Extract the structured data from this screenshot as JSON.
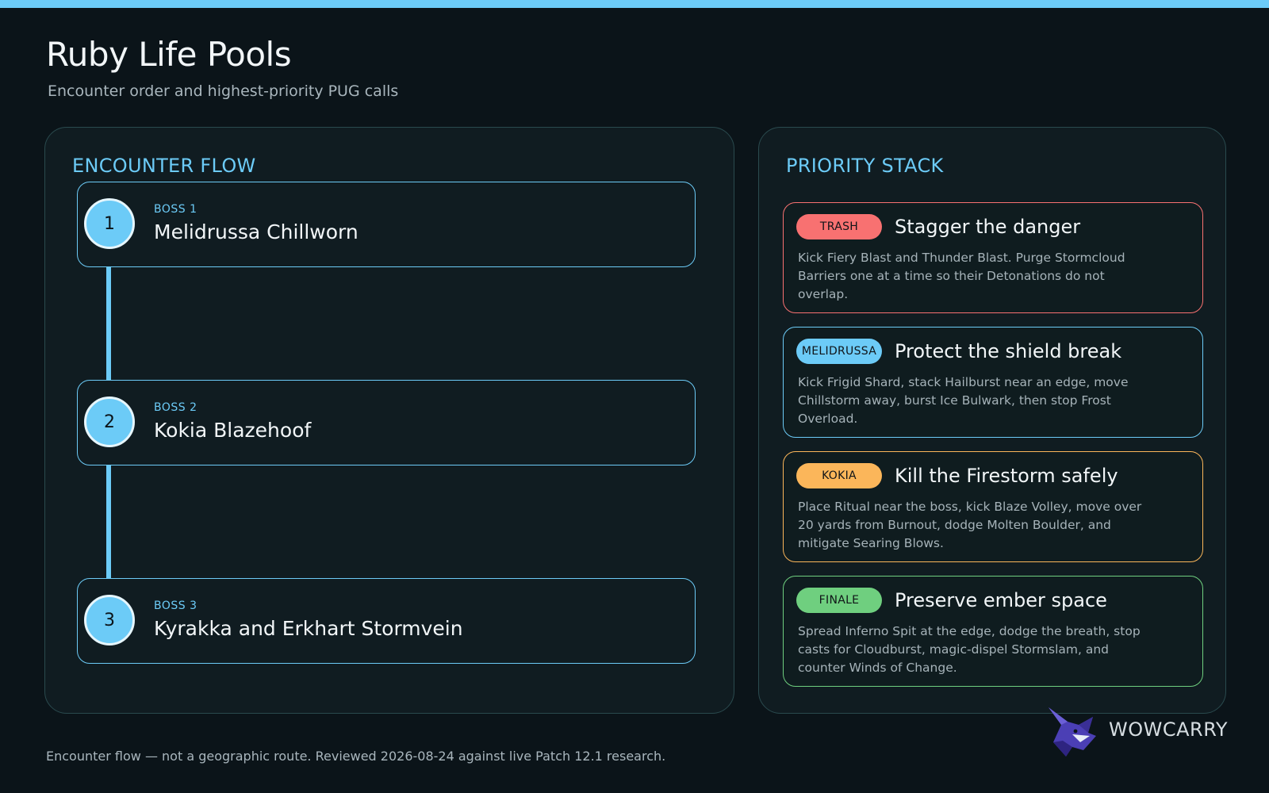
{
  "page": {
    "title": "Ruby Life Pools",
    "subtitle": "Encounter order and highest-priority PUG calls",
    "accent_color": "#6ccbf7"
  },
  "encounter_flow": {
    "heading": "ENCOUNTER FLOW",
    "bosses": [
      {
        "number": "1",
        "tag": "BOSS 1",
        "name": "Melidrussa Chillworn"
      },
      {
        "number": "2",
        "tag": "BOSS 2",
        "name": "Kokia Blazehoof"
      },
      {
        "number": "3",
        "tag": "BOSS 3",
        "name": "Kyrakka and Erkhart Stormvein"
      }
    ]
  },
  "priority_stack": {
    "heading": "PRIORITY STACK",
    "items": [
      {
        "badge": "TRASH",
        "title": "Stagger the danger",
        "body": "Kick Fiery Blast and Thunder Blast. Purge Stormcloud Barriers one at a time so their Detonations do not overlap.",
        "color": "#f87171"
      },
      {
        "badge": "MELIDRUSSA",
        "title": "Protect the shield break",
        "body": "Kick Frigid Shard, stack Hailburst near an edge, move Chillstorm away, burst Ice Bulwark, then stop Frost Overload.",
        "color": "#6ccbf7"
      },
      {
        "badge": "KOKIA",
        "title": "Kill the Firestorm safely",
        "body": "Place Ritual near the boss, kick Blaze Volley, move over 20 yards from Burnout, dodge Molten Boulder, and mitigate Searing Blows.",
        "color": "#fbb65a"
      },
      {
        "badge": "FINALE",
        "title": "Preserve ember space",
        "body": "Spread Inferno Spit at the edge, dodge the breath, stop casts for Cloudburst, magic-dispel Stormslam, and counter Winds of Change.",
        "color": "#6fcf7f"
      }
    ]
  },
  "footer": {
    "note": "Encounter flow — not a geographic route. Reviewed 2026-08-24 against live Patch 12.1 research."
  },
  "brand": {
    "name": "WOWCARRY",
    "logo_icon": "fox-logo-icon"
  }
}
